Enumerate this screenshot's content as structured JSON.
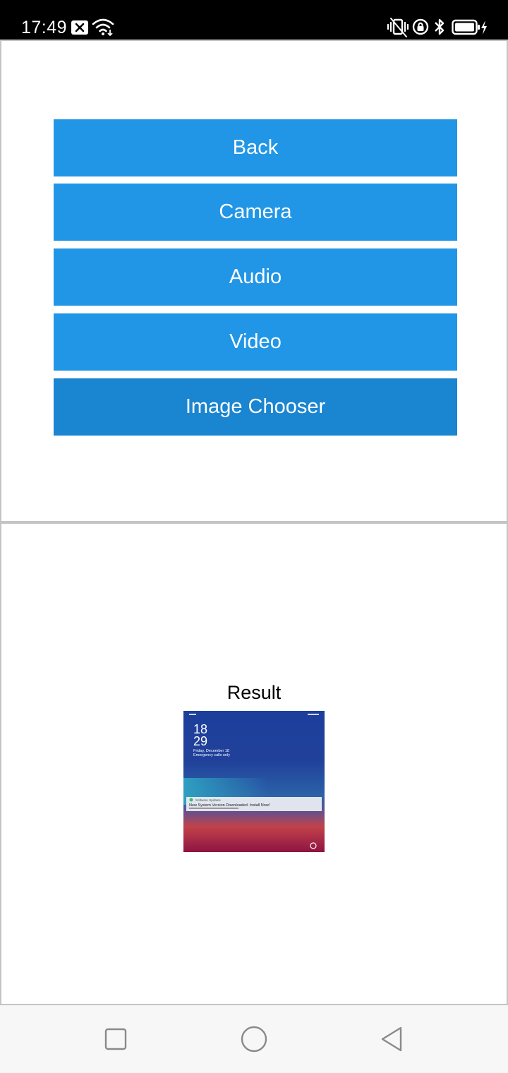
{
  "status_bar": {
    "time": "17:49",
    "icons": [
      "close-box-icon",
      "wifi-icon",
      "vibrate-icon",
      "rotation-lock-icon",
      "bluetooth-icon",
      "battery-charging-icon"
    ]
  },
  "buttons": [
    {
      "label": "Back",
      "name": "back-button"
    },
    {
      "label": "Camera",
      "name": "camera-button"
    },
    {
      "label": "Audio",
      "name": "audio-button"
    },
    {
      "label": "Video",
      "name": "video-button"
    },
    {
      "label": "Image Chooser",
      "name": "image-chooser-button",
      "active": true
    }
  ],
  "result": {
    "label": "Result",
    "thumbnail": {
      "time_hour": "18",
      "time_minute": "29",
      "date": "Friday, December 18",
      "subtitle": "Emergency calls only",
      "notification_app": "Software Updates",
      "notification_text": "New System Version Downloaded. Install Now!"
    }
  },
  "nav_bar": {
    "icons": [
      "recent-apps-icon",
      "home-icon",
      "back-nav-icon"
    ]
  },
  "colors": {
    "button": "#2196e6",
    "button_active": "#1a85d0",
    "status_bar": "#000000",
    "nav_bar": "#f7f7f7"
  }
}
